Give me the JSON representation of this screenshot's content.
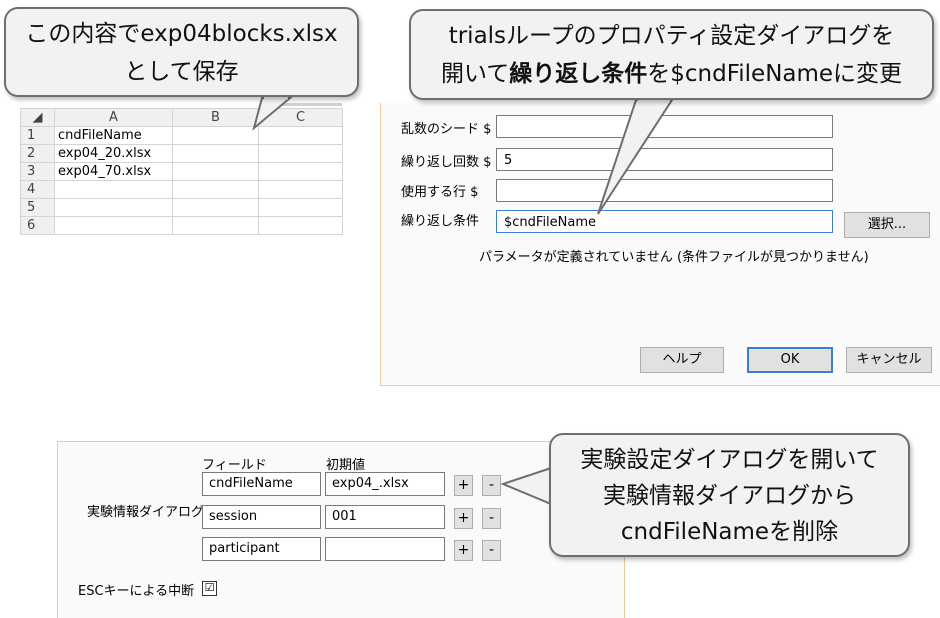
{
  "spreadsheet": {
    "columns": [
      "A",
      "B",
      "C"
    ],
    "rows": [
      {
        "num": "1",
        "a": "cndFileName"
      },
      {
        "num": "2",
        "a": "exp04_20.xlsx"
      },
      {
        "num": "3",
        "a": "exp04_70.xlsx"
      },
      {
        "num": "4",
        "a": ""
      },
      {
        "num": "5",
        "a": ""
      },
      {
        "num": "6",
        "a": ""
      }
    ]
  },
  "loop_dialog": {
    "seed_label": "乱数のシード $",
    "nreps_label": "繰り返し回数 $",
    "nreps_value": "5",
    "rows_label": "使用する行 $",
    "conditions_label": "繰り返し条件",
    "conditions_value": "$cndFileName",
    "browse_button": "選択...",
    "message": "パラメータが定義されていません (条件ファイルが見つかりません)",
    "help_button": "ヘルプ",
    "ok_button": "OK",
    "cancel_button": "キャンセル"
  },
  "exp_dialog": {
    "field_header": "フィールド",
    "default_header": "初期値",
    "info_label": "実験情報ダイアログ",
    "fields": [
      {
        "name": "cndFileName",
        "value": "exp04_.xlsx"
      },
      {
        "name": "session",
        "value": "001"
      },
      {
        "name": "participant",
        "value": ""
      }
    ],
    "add_symbol": "+",
    "remove_symbol": "-",
    "esc_label": "ESCキーによる中断",
    "esc_checked": "☑"
  },
  "callouts": {
    "save": [
      "この内容でexp04blocks.xlsx",
      "として保存"
    ],
    "loop": {
      "line1": "trialsループのプロパティ設定ダイアログを",
      "line2_pre": "開いて",
      "line2_bold": "繰り返し条件",
      "line2_post": "を$cndFileNameに変更"
    },
    "exp": [
      "実験設定ダイアログを開いて",
      "実験情報ダイアログから",
      "cndFileNameを削除"
    ]
  }
}
